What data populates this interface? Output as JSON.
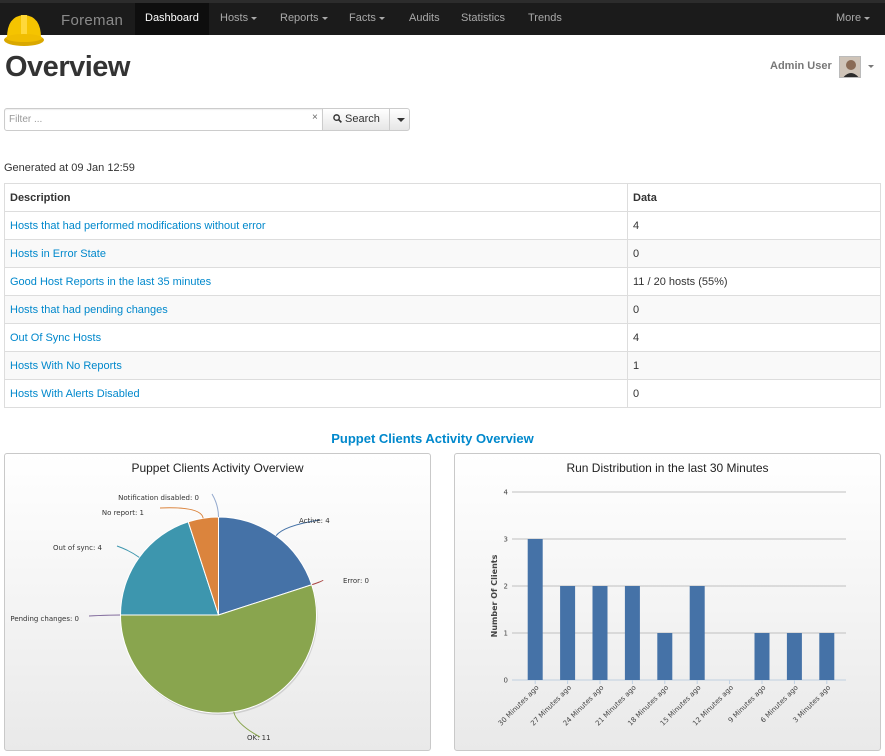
{
  "navbar": {
    "brand": "Foreman",
    "items": [
      {
        "label": "Dashboard",
        "active": true,
        "dropdown": false
      },
      {
        "label": "Hosts",
        "active": false,
        "dropdown": true
      },
      {
        "label": "Reports",
        "active": false,
        "dropdown": true
      },
      {
        "label": "Facts",
        "active": false,
        "dropdown": true
      },
      {
        "label": "Audits",
        "active": false,
        "dropdown": false
      },
      {
        "label": "Statistics",
        "active": false,
        "dropdown": false
      },
      {
        "label": "Trends",
        "active": false,
        "dropdown": false
      }
    ],
    "more_label": "More",
    "logo_icon": "hard-hat-icon"
  },
  "header": {
    "title": "Overview",
    "user_name": "Admin User"
  },
  "search": {
    "placeholder": "Filter ...",
    "value": "",
    "clear_symbol": "×",
    "button_label": "Search"
  },
  "generated_at": "Generated at 09 Jan 12:59",
  "table": {
    "headers": [
      "Description",
      "Data"
    ],
    "rows": [
      {
        "description": "Hosts that had performed modifications without error",
        "data": "4"
      },
      {
        "description": "Hosts in Error State",
        "data": "0"
      },
      {
        "description": "Good Host Reports in the last 35 minutes",
        "data": "11 / 20 hosts (55%)"
      },
      {
        "description": "Hosts that had pending changes",
        "data": "0"
      },
      {
        "description": "Out Of Sync Hosts",
        "data": "4"
      },
      {
        "description": "Hosts With No Reports",
        "data": "1"
      },
      {
        "description": "Hosts With Alerts Disabled",
        "data": "0"
      }
    ]
  },
  "section_title": "Puppet Clients Activity Overview",
  "colors": {
    "active": "#4572a7",
    "error": "#aa4643",
    "ok": "#89a54e",
    "pending": "#80699b",
    "out_of_sync": "#3d96ae",
    "no_report": "#db843d",
    "notification_disabled": "#92a8cd",
    "bar": "#4572a7",
    "link": "#0088cc"
  },
  "chart_data": [
    {
      "type": "pie",
      "title": "Puppet Clients Activity Overview",
      "slices": [
        {
          "label": "Active",
          "value": 4,
          "color_key": "active"
        },
        {
          "label": "Error",
          "value": 0,
          "color_key": "error"
        },
        {
          "label": "OK",
          "value": 11,
          "color_key": "ok"
        },
        {
          "label": "Pending changes",
          "value": 0,
          "color_key": "pending"
        },
        {
          "label": "Out of sync",
          "value": 4,
          "color_key": "out_of_sync"
        },
        {
          "label": "No report",
          "value": 1,
          "color_key": "no_report"
        },
        {
          "label": "Notification disabled",
          "value": 0,
          "color_key": "notification_disabled"
        }
      ]
    },
    {
      "type": "bar",
      "title": "Run Distribution in the last 30 Minutes",
      "ylabel": "Number Of Clients",
      "ylim": [
        0,
        4
      ],
      "yticks": [
        0,
        1,
        2,
        3,
        4
      ],
      "categories": [
        "30 Minutes ago",
        "27 Minutes ago",
        "24 Minutes ago",
        "21 Minutes ago",
        "18 Minutes ago",
        "15 Minutes ago",
        "12 Minutes ago",
        "9 Minutes ago",
        "6 Minutes ago",
        "3 Minutes ago"
      ],
      "values": [
        3,
        2,
        2,
        2,
        1,
        2,
        0,
        1,
        1,
        1
      ],
      "grid": true,
      "legend": "none"
    }
  ]
}
